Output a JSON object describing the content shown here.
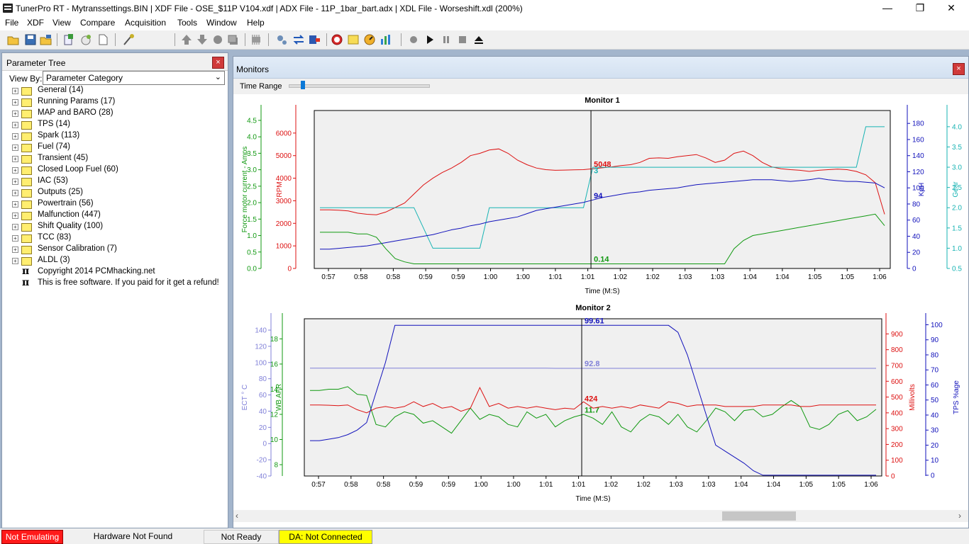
{
  "window": {
    "title": "TunerPro RT - Mytranssettings.BIN | XDF File - OSE_$11P V104.xdf | ADX File - 11P_1bar_bart.adx | XDL File - Worseshift.xdl (200%)",
    "minimize": "—",
    "maximize": "❐",
    "close": "✕"
  },
  "menu": [
    "File",
    "XDF",
    "View",
    "Compare",
    "Acquisition",
    "Tools",
    "Window",
    "Help"
  ],
  "parameter_tree": {
    "title": "Parameter Tree",
    "view_by_label": "View By:",
    "view_by_value": "Parameter Category",
    "categories": [
      "General (14)",
      "Running Params (17)",
      "MAP and BARO (28)",
      "TPS (14)",
      "Spark (113)",
      "Fuel (74)",
      "Transient (45)",
      "Closed Loop Fuel (60)",
      "IAC (53)",
      "Outputs (25)",
      "Powertrain (56)",
      "Malfunction (447)",
      "Shift Quality (100)",
      "TCC (83)",
      "Sensor Calibration (7)",
      "ALDL (3)"
    ],
    "notes": [
      "Copyright 2014 PCMhacking.net",
      "This is free software. If you paid for it get a refund!"
    ]
  },
  "monitors": {
    "title": "Monitors",
    "time_range_label": "Time Range",
    "time_range_position": 0.1
  },
  "chart_data": [
    {
      "type": "line",
      "title": "Monitor 1",
      "xlabel": "Time (M:S)",
      "x_tick_labels": [
        "0:57",
        "0:58",
        "0:58",
        "0:59",
        "0:59",
        "1:00",
        "1:00",
        "1:01",
        "1:01",
        "1:02",
        "1:02",
        "1:03",
        "1:03",
        "1:04",
        "1:04",
        "1:05",
        "1:05",
        "1:06"
      ],
      "x": [
        0,
        1,
        2,
        3,
        4,
        5,
        6,
        7,
        8,
        9,
        10,
        11,
        12,
        13,
        14,
        15,
        16,
        17,
        18,
        19,
        20,
        21,
        22,
        23,
        24,
        25,
        26,
        27,
        28,
        29,
        30,
        31,
        32,
        33,
        34,
        35,
        36,
        37,
        38,
        39,
        40,
        41,
        42,
        43,
        44,
        45,
        46,
        47,
        48,
        49,
        50,
        51,
        52,
        53,
        54,
        55,
        56,
        57,
        58,
        59,
        60
      ],
      "xlim": [
        -0.6,
        60.6
      ],
      "cursor_x": 28.8,
      "axes": [
        {
          "label": "Force motor current - Amps",
          "color": "#119911",
          "side": "left",
          "min": 0,
          "max": 4.8,
          "ticks": [
            0.0,
            0.5,
            1.0,
            1.5,
            2.0,
            2.5,
            3.0,
            3.5,
            4.0,
            4.5
          ],
          "tick_labels": [
            "0.0",
            "0.5",
            "1.0",
            "1.5",
            "2.0",
            "2.5",
            "3.0",
            "3.5",
            "4.0",
            "4.5"
          ]
        },
        {
          "label": "RPM",
          "color": "#dd1111",
          "side": "left",
          "min": 0,
          "max": 7000,
          "ticks": [
            0,
            1000,
            2000,
            3000,
            4000,
            5000,
            6000
          ],
          "tick_labels": [
            "0",
            "1000",
            "2000",
            "3000",
            "4000",
            "5000",
            "6000"
          ]
        },
        {
          "label": "KpH",
          "color": "#1111bb",
          "side": "right",
          "min": 0,
          "max": 196,
          "ticks": [
            0,
            20,
            40,
            60,
            80,
            100,
            120,
            140,
            160,
            180
          ],
          "tick_labels": [
            "0",
            "20",
            "40",
            "60",
            "80",
            "100",
            "120",
            "140",
            "160",
            "180"
          ]
        },
        {
          "label": "Gear",
          "color": "#17b3b3",
          "side": "right",
          "min": 0.5,
          "max": 4.4,
          "ticks": [
            0.5,
            1.0,
            1.5,
            2.0,
            2.5,
            3.0,
            3.5,
            4.0
          ],
          "tick_labels": [
            "0.5",
            "1.0",
            "1.5",
            "2.0",
            "2.5",
            "3.0",
            "3.5",
            "4.0"
          ]
        }
      ],
      "series": [
        {
          "axis": 1,
          "color": "#dd1111",
          "cursor_label": "5048",
          "values": [
            2600,
            2600,
            2580,
            2550,
            2450,
            2400,
            2380,
            2500,
            2700,
            2900,
            3300,
            3700,
            4000,
            4250,
            4450,
            4700,
            5000,
            5100,
            5250,
            5300,
            5100,
            4800,
            4600,
            4450,
            4380,
            4350,
            4360,
            4370,
            4380,
            4420,
            4460,
            4500,
            4560,
            4600,
            4700,
            4880,
            4900,
            4880,
            4950,
            5000,
            5048,
            4900,
            4700,
            4800,
            5100,
            5200,
            5000,
            4700,
            4500,
            4420,
            4380,
            4350,
            4300,
            4350,
            4380,
            4400,
            4380,
            4300,
            4150,
            3800,
            2400
          ]
        },
        {
          "axis": 3,
          "color": "#17b3b3",
          "cursor_label": "3",
          "values": [
            2,
            2,
            2,
            2,
            2,
            2,
            2,
            2,
            2,
            2,
            2,
            1.5,
            1,
            1,
            1,
            1,
            1,
            1,
            2,
            2,
            2,
            2,
            2,
            2,
            2,
            2,
            2,
            2,
            2,
            3,
            3,
            3,
            3,
            3,
            3,
            3,
            3,
            3,
            3,
            3,
            3,
            3,
            3,
            3,
            3,
            3,
            3,
            3,
            3,
            3,
            3,
            3,
            3,
            3,
            3,
            3,
            3,
            3,
            4,
            4,
            4
          ]
        },
        {
          "axis": 2,
          "color": "#1111bb",
          "cursor_label": "94",
          "values": [
            24,
            24,
            25,
            26,
            27,
            28,
            30,
            32,
            34,
            36,
            38,
            40,
            42,
            45,
            48,
            50,
            53,
            55,
            58,
            60,
            62,
            64,
            68,
            72,
            74,
            76,
            78,
            80,
            82,
            85,
            88,
            90,
            92,
            94,
            95,
            97,
            98,
            99,
            100,
            102,
            104,
            105,
            106,
            107,
            108,
            109,
            110,
            110,
            110,
            109,
            108,
            109,
            110,
            112,
            110,
            109,
            108,
            108,
            107,
            106,
            100
          ]
        },
        {
          "axis": 0,
          "color": "#119911",
          "cursor_label": "0.14",
          "values": [
            1.1,
            1.1,
            1.1,
            1.1,
            1.05,
            1.05,
            0.95,
            0.6,
            0.3,
            0.2,
            0.14,
            0.14,
            0.14,
            0.14,
            0.14,
            0.14,
            0.14,
            0.14,
            0.14,
            0.14,
            0.14,
            0.14,
            0.14,
            0.14,
            0.14,
            0.14,
            0.14,
            0.14,
            0.14,
            0.14,
            0.14,
            0.14,
            0.14,
            0.14,
            0.14,
            0.14,
            0.14,
            0.14,
            0.14,
            0.14,
            0.14,
            0.14,
            0.14,
            0.14,
            0.6,
            0.85,
            1.0,
            1.05,
            1.1,
            1.15,
            1.2,
            1.25,
            1.3,
            1.35,
            1.4,
            1.45,
            1.5,
            1.55,
            1.6,
            1.65,
            1.3
          ]
        }
      ]
    },
    {
      "type": "line",
      "title": "Monitor 2",
      "xlabel": "Time (M:S)",
      "x_tick_labels": [
        "0:57",
        "0:58",
        "0:58",
        "0:59",
        "0:59",
        "1:00",
        "1:00",
        "1:01",
        "1:01",
        "1:02",
        "1:02",
        "1:03",
        "1:03",
        "1:04",
        "1:04",
        "1:05",
        "1:05",
        "1:06"
      ],
      "x": [
        0,
        1,
        2,
        3,
        4,
        5,
        6,
        7,
        8,
        9,
        10,
        11,
        12,
        13,
        14,
        15,
        16,
        17,
        18,
        19,
        20,
        21,
        22,
        23,
        24,
        25,
        26,
        27,
        28,
        29,
        30,
        31,
        32,
        33,
        34,
        35,
        36,
        37,
        38,
        39,
        40,
        41,
        42,
        43,
        44,
        45,
        46,
        47,
        48,
        49,
        50,
        51,
        52,
        53,
        54,
        55,
        56,
        57,
        58,
        59,
        60
      ],
      "xlim": [
        -0.6,
        60.6
      ],
      "cursor_x": 28.8,
      "axes": [
        {
          "label": "ECT ° C",
          "color": "#8080d8",
          "side": "left",
          "min": -40,
          "max": 154,
          "ticks": [
            -40,
            -20,
            0,
            20,
            40,
            60,
            80,
            100,
            120,
            140
          ],
          "tick_labels": [
            "-40",
            "-20",
            "0",
            "20",
            "40",
            "60",
            "80",
            "100",
            "120",
            "140"
          ]
        },
        {
          "label": "WB AFR",
          "color": "#119911",
          "side": "left",
          "min": 7.1,
          "max": 19.6,
          "ticks": [
            8,
            10,
            12,
            14,
            16,
            18
          ],
          "tick_labels": [
            "8",
            "10",
            "12",
            "14",
            "16",
            "18"
          ]
        },
        {
          "label": "Millivolts",
          "color": "#dd1111",
          "side": "right",
          "min": 0,
          "max": 996,
          "ticks": [
            0,
            100,
            200,
            300,
            400,
            500,
            600,
            700,
            800,
            900
          ],
          "tick_labels": [
            "0",
            "100",
            "200",
            "300",
            "400",
            "500",
            "600",
            "700",
            "800",
            "900"
          ]
        },
        {
          "label": "TPS %age",
          "color": "#1111bb",
          "side": "right",
          "min": -0.5,
          "max": 104,
          "ticks": [
            0,
            10,
            20,
            30,
            40,
            50,
            60,
            70,
            80,
            90,
            100
          ],
          "tick_labels": [
            "0",
            "10",
            "20",
            "30",
            "40",
            "50",
            "60",
            "70",
            "80",
            "90",
            "100"
          ]
        }
      ],
      "series": [
        {
          "axis": 0,
          "color": "#8080d8",
          "cursor_label": "92.8",
          "values": [
            93,
            93,
            93,
            93,
            93,
            93,
            93,
            93,
            93,
            93,
            93,
            93,
            93,
            93,
            93,
            93,
            93,
            93,
            93,
            93,
            93,
            93,
            93,
            93,
            93,
            93,
            92.8,
            92.8,
            92.8,
            92.8,
            92.8,
            92.8,
            92.8,
            92.8,
            92.8,
            92.8,
            92.8,
            92.8,
            92.8,
            92.8,
            92.8,
            92.8,
            92.8,
            92.8,
            92.8,
            92.8,
            92.8,
            92.8,
            92.8,
            92.8,
            92.8,
            92.8,
            92.8,
            92.8,
            92.8,
            92.8,
            92.8,
            92.8,
            92.8,
            92.8,
            92.8
          ]
        },
        {
          "axis": 1,
          "color": "#119911",
          "cursor_label": "11.7",
          "values": [
            13.9,
            13.9,
            14.0,
            14.0,
            14.2,
            13.6,
            13.5,
            11.2,
            11.0,
            11.8,
            12.2,
            12.0,
            11.3,
            11.5,
            11.0,
            10.5,
            11.5,
            12.5,
            11.6,
            12.0,
            11.8,
            11.2,
            11.0,
            12.2,
            11.7,
            12.0,
            11.0,
            11.5,
            11.8,
            12.0,
            11.7,
            11.2,
            12.2,
            11.0,
            10.6,
            11.5,
            12.0,
            11.8,
            11.2,
            12.0,
            11.0,
            10.6,
            11.5,
            12.5,
            12.2,
            11.5,
            12.3,
            12.4,
            11.8,
            12.0,
            12.6,
            13.1,
            12.6,
            11.0,
            10.8,
            11.2,
            12.0,
            12.3,
            11.5,
            11.8,
            12.4
          ]
        },
        {
          "axis": 2,
          "color": "#dd1111",
          "cursor_label": "424",
          "values": [
            450,
            450,
            448,
            445,
            450,
            420,
            400,
            430,
            440,
            430,
            440,
            470,
            440,
            460,
            430,
            440,
            410,
            430,
            560,
            440,
            460,
            430,
            440,
            430,
            440,
            430,
            420,
            430,
            424,
            470,
            430,
            440,
            430,
            440,
            430,
            450,
            440,
            430,
            470,
            460,
            440,
            450,
            450,
            450,
            440,
            440,
            440,
            440,
            450,
            450,
            450,
            450,
            440,
            440,
            450,
            450,
            450,
            450,
            450,
            450,
            450
          ]
        },
        {
          "axis": 3,
          "color": "#1111bb",
          "cursor_label": "99.61",
          "values": [
            23,
            23,
            24,
            25,
            27,
            30,
            35,
            55,
            75,
            99.6,
            99.6,
            99.6,
            99.6,
            99.6,
            99.6,
            99.6,
            99.6,
            99.6,
            99.6,
            99.6,
            99.6,
            99.6,
            99.6,
            99.6,
            99.6,
            99.6,
            99.6,
            99.6,
            99.6,
            99.6,
            99.6,
            99.6,
            99.6,
            99.6,
            99.6,
            99.6,
            99.6,
            99.6,
            99.6,
            95,
            80,
            60,
            40,
            20,
            16,
            12,
            8,
            3,
            0,
            0,
            0,
            0,
            0,
            0,
            0,
            0,
            0,
            0,
            0,
            0,
            0
          ]
        }
      ]
    }
  ],
  "status": {
    "emulation": "Not Emulating",
    "hardware": "Hardware Not Found",
    "ready": "Not Ready",
    "da": "DA: Not Connected"
  },
  "colors": {
    "workspace_bg": "#a3b5cc",
    "status_red": "#ff1a1a",
    "status_yellow": "#ffff00",
    "chart_bg": "#f0f0f0"
  }
}
